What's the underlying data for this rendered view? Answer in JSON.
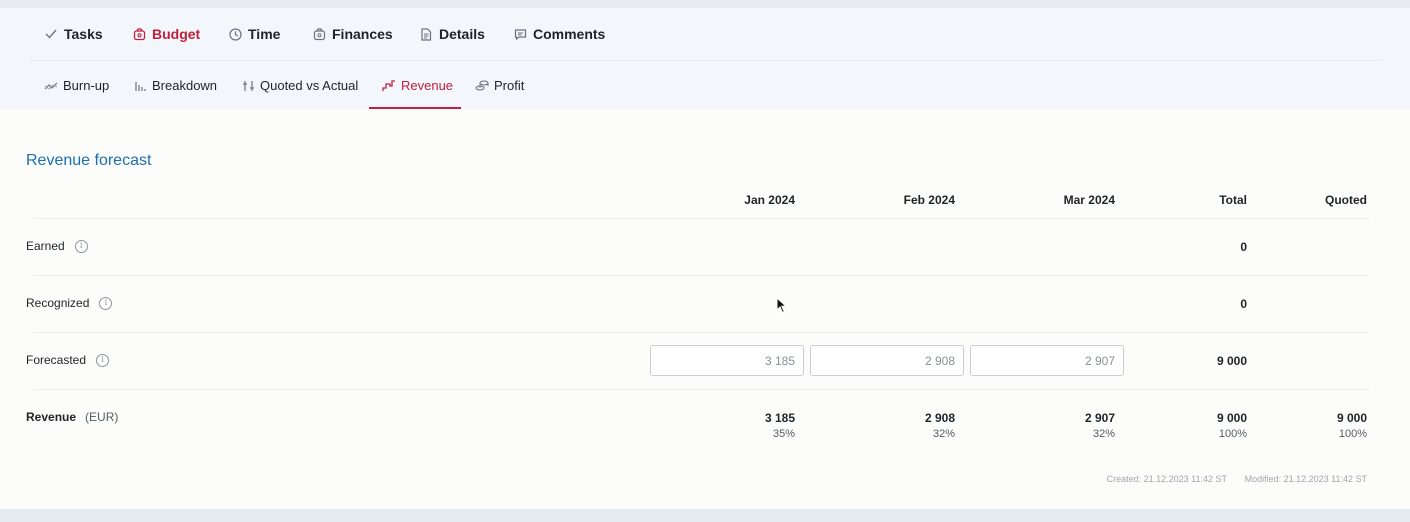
{
  "main_tabs": [
    {
      "label": "Tasks",
      "icon": "check-icon"
    },
    {
      "label": "Budget",
      "icon": "budget-icon",
      "active": true
    },
    {
      "label": "Time",
      "icon": "clock-icon"
    },
    {
      "label": "Finances",
      "icon": "finances-icon"
    },
    {
      "label": "Details",
      "icon": "document-icon"
    },
    {
      "label": "Comments",
      "icon": "comment-icon"
    }
  ],
  "sub_tabs": [
    {
      "label": "Burn-up",
      "icon": "burnup-icon"
    },
    {
      "label": "Breakdown",
      "icon": "breakdown-icon"
    },
    {
      "label": "Quoted vs Actual",
      "icon": "quoted-vs-actual-icon"
    },
    {
      "label": "Revenue",
      "icon": "revenue-icon",
      "active": true
    },
    {
      "label": "Profit",
      "icon": "coins-icon"
    }
  ],
  "section_title": "Revenue forecast",
  "columns": [
    "Jan 2024",
    "Feb 2024",
    "Mar 2024",
    "Total",
    "Quoted"
  ],
  "rows": {
    "earned": {
      "label": "Earned",
      "total": "0"
    },
    "recognized": {
      "label": "Recognized",
      "total": "0"
    },
    "forecasted": {
      "label": "Forecasted",
      "inputs": [
        "3 185",
        "2 908",
        "2 907"
      ],
      "total": "9 000"
    },
    "revenue": {
      "label": "Revenue",
      "unit": "(EUR)",
      "values": [
        "3 185",
        "2 908",
        "2 907",
        "9 000",
        "9 000"
      ],
      "percents": [
        "35%",
        "32%",
        "32%",
        "100%",
        "100%"
      ]
    }
  },
  "meta": {
    "created": "Created: 21.12.2023 11:42 ST",
    "modified": "Modified: 21.12.2023 11:42 ST"
  },
  "colors": {
    "accent": "#c0213e",
    "title": "#1a6fb0"
  }
}
